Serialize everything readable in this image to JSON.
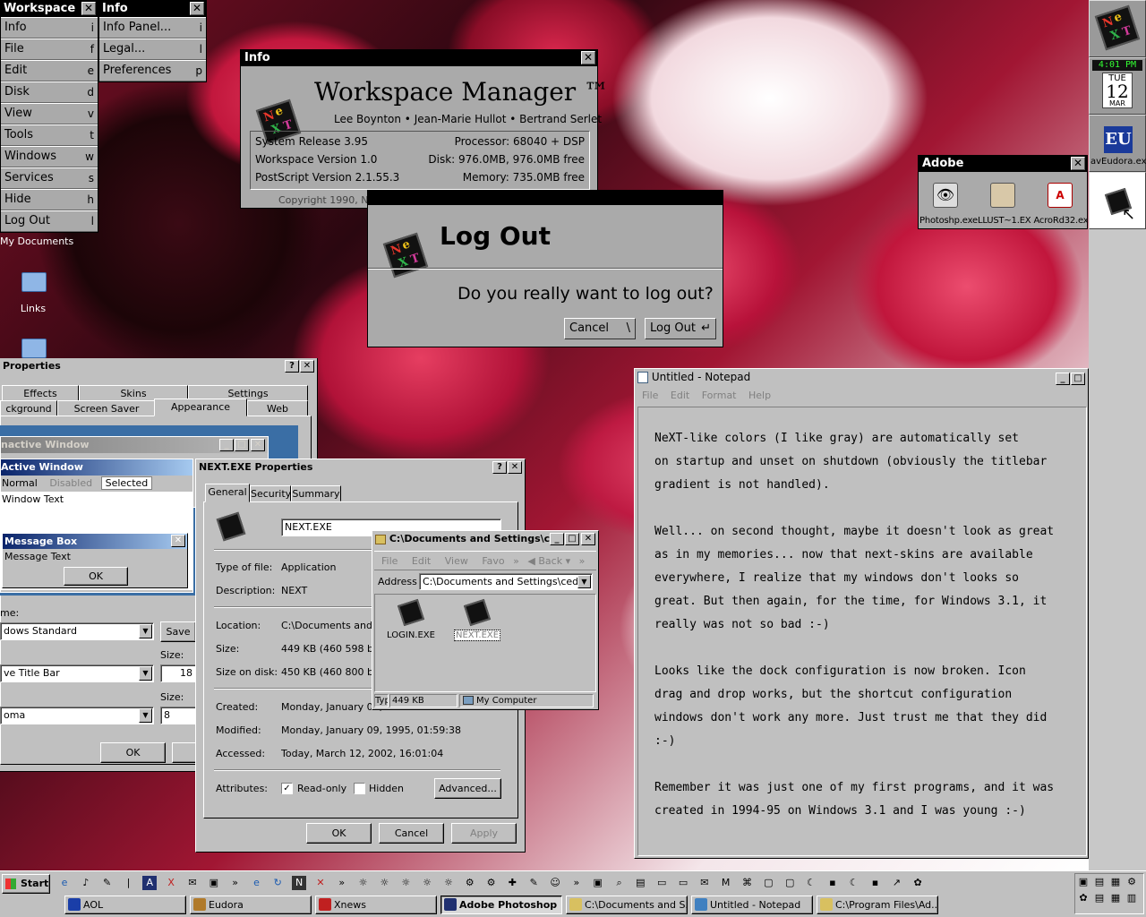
{
  "workspace_menu": {
    "title": "Workspace",
    "items": [
      {
        "label": "Info",
        "key": "i"
      },
      {
        "label": "File",
        "key": "f"
      },
      {
        "label": "Edit",
        "key": "e"
      },
      {
        "label": "Disk",
        "key": "d"
      },
      {
        "label": "View",
        "key": "v"
      },
      {
        "label": "Tools",
        "key": "t"
      },
      {
        "label": "Windows",
        "key": "w"
      },
      {
        "label": "Services",
        "key": "s"
      },
      {
        "label": "Hide",
        "key": "h"
      },
      {
        "label": "Log Out",
        "key": "l"
      }
    ]
  },
  "info_menu": {
    "title": "Info",
    "items": [
      {
        "label": "Info Panel...",
        "key": "i"
      },
      {
        "label": "Legal...",
        "key": "l"
      },
      {
        "label": "Preferences",
        "key": "p"
      }
    ]
  },
  "info_panel": {
    "title": "Info",
    "app_name": "Workspace Manager ™",
    "authors": "Lee Boynton • Jean-Marie Hullot • Bertrand Serlet",
    "release": "System Release 3.95",
    "processor": "Processor: 68040 + DSP",
    "workspace_version": "Workspace Version 1.0",
    "disk": "Disk: 976.0MB, 976.0MB free",
    "postscript": "PostScript Version 2.1.55.3",
    "memory": "Memory: 735.0MB free",
    "copyright": "Copyright 1990, N"
  },
  "logout_dialog": {
    "title": "Log Out",
    "question": "Do you really want to log out?",
    "cancel": "Cancel",
    "cancel_key": "\\",
    "confirm": "Log Out",
    "confirm_key": "↵"
  },
  "desktop": {
    "my_documents": "My Documents",
    "links": "Links"
  },
  "adobe_shelf": {
    "title": "Adobe",
    "items": [
      "Photoshp.exe",
      "LLUST~1.EX",
      "AcroRd32.ex"
    ]
  },
  "dock": {
    "time": "4:01 PM",
    "day": "TUE",
    "date": "12",
    "month": "MAR",
    "eudora_label": "Eudora.exe",
    "eudora_prefix": "av",
    "eudora_badge": "EU"
  },
  "display_props": {
    "title": "Properties",
    "tabs_row1": [
      "Effects",
      "Skins",
      "Settings"
    ],
    "tabs_row2": [
      "ckground",
      "Screen Saver",
      "Appearance",
      "Web"
    ],
    "preview_inactive": "nactive Window",
    "preview_active": "Active Window",
    "menu_normal": "Normal",
    "menu_disabled": "Disabled",
    "menu_selected": "Selected",
    "window_text": "Window Text",
    "msgbox_title": "Message Box",
    "msgbox_text": "Message Text",
    "msgbox_ok": "OK",
    "scheme_label": "me:",
    "scheme_value": "dows Standard",
    "save_btn": "Save",
    "size_label1": "Size:",
    "item_value": "ve Title Bar",
    "size_value1": "18",
    "size_label2": "Size:",
    "font_value": "oma",
    "size_value2": "8",
    "ok": "OK",
    "cancel_partial": "C"
  },
  "next_props": {
    "title": "NEXT.EXE Properties",
    "tabs": [
      "General",
      "Security",
      "Summary"
    ],
    "filename": "NEXT.EXE",
    "type_label": "Type of file:",
    "type_value": "Application",
    "desc_label": "Description:",
    "desc_value": "NEXT",
    "location_label": "Location:",
    "location_value": "C:\\Documents and S",
    "size_label": "Size:",
    "size_value": "449 KB (460 598 byt",
    "disk_label": "Size on disk:",
    "disk_value": "450 KB (460 800 byt",
    "created_label": "Created:",
    "created_value": "Monday, January 09,",
    "modified_label": "Modified:",
    "modified_value": "Monday, January 09, 1995, 01:59:38",
    "accessed_label": "Accessed:",
    "accessed_value": "Today, March 12, 2002, 16:01:04",
    "attr_label": "Attributes:",
    "readonly": "Read-only",
    "hidden": "Hidden",
    "advanced": "Advanced...",
    "ok": "OK",
    "cancel": "Cancel",
    "apply": "Apply"
  },
  "explorer": {
    "title": "C:\\Documents and Settings\\c...",
    "menu": [
      "File",
      "Edit",
      "View",
      "Favo"
    ],
    "back": "Back",
    "address_label": "Address",
    "address_value": "C:\\Documents and Settings\\cedr",
    "files": [
      "LOGIN.EXE",
      "NEXT.EXE"
    ],
    "status_type": "Typ",
    "status_size": "449 KB",
    "status_zone": "My Computer"
  },
  "notepad": {
    "title": "Untitled - Notepad",
    "menu": [
      "File",
      "Edit",
      "Format",
      "Help"
    ],
    "lines": [
      "NeXT-like colors (I like gray) are automatically set",
      "on startup and unset on shutdown (obviously the titlebar",
      "gradient is not handled).",
      "",
      "Well... on second thought, maybe it doesn't look as great",
      "as in my memories... now that next-skins are available",
      "everywhere, I realize that my windows don't looks so",
      "great. But then again, for the time, for Windows 3.1, it",
      "really was not so bad :-)",
      "",
      "Looks like the dock configuration is now broken. Icon",
      "drag and drop works, but the shortcut configuration",
      "windows don't work any more. Just trust me that they did",
      ":-)",
      "",
      "Remember it was just one of my first programs, and it was",
      "created in 1994-95 on Windows 3.1 and I was young :-)"
    ]
  },
  "taskbar": {
    "start": "Start",
    "tasks": [
      {
        "label": "AOL",
        "color": "#1a3ea8"
      },
      {
        "label": "Eudora",
        "color": "#b07a2a"
      },
      {
        "label": "Xnews",
        "color": "#c02020"
      },
      {
        "label": "Adobe Photoshop",
        "color": "#203070"
      },
      {
        "label": "C:\\Documents and S...",
        "color": "#d8c060"
      },
      {
        "label": "Untitled - Notepad",
        "color": "#4080c0"
      },
      {
        "label": "C:\\Program Files\\Ad...",
        "color": "#d8c060"
      }
    ]
  }
}
